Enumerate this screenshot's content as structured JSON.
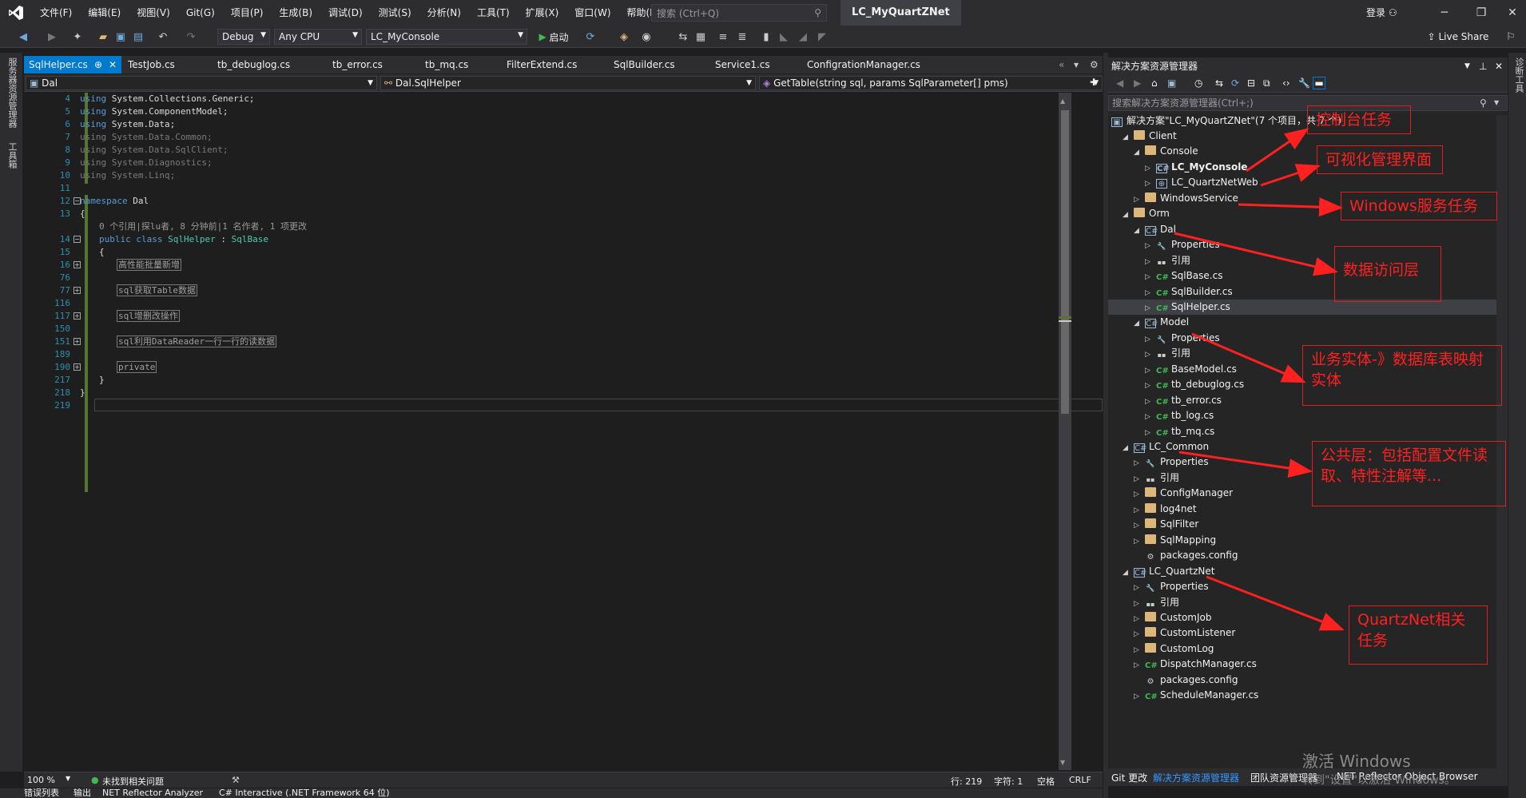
{
  "title_bar": {
    "menus": [
      "文件(F)",
      "编辑(E)",
      "视图(V)",
      "Git(G)",
      "项目(P)",
      "生成(B)",
      "调试(D)",
      "测试(S)",
      "分析(N)",
      "工具(T)",
      "扩展(X)",
      "窗口(W)",
      "帮助(H)"
    ],
    "search_placeholder": "搜索 (Ctrl+Q)",
    "solution_name": "LC_MyQuartZNet",
    "login": "登录",
    "window_buttons": [
      "─",
      "❐",
      "✕"
    ]
  },
  "toolbar": {
    "config": "Debug",
    "platform": "Any CPU",
    "startup_project": "LC_MyConsole",
    "start_label": "启动",
    "live_share": "Live Share"
  },
  "left_sidebar": {
    "server_explorer": "服务器资源管理器",
    "toolbox": "工具箱"
  },
  "tabs": [
    {
      "label": "SqlHelper.cs",
      "pin": "⊕",
      "close": "✕",
      "active": true
    },
    {
      "label": "TestJob.cs"
    },
    {
      "label": "tb_debuglog.cs"
    },
    {
      "label": "tb_error.cs"
    },
    {
      "label": "tb_mq.cs"
    },
    {
      "label": "FilterExtend.cs"
    },
    {
      "label": "SqlBuilder.cs"
    },
    {
      "label": "Service1.cs"
    },
    {
      "label": "ConfigrationManager.cs"
    }
  ],
  "navbar": {
    "project": "Dal",
    "type": "Dal.SqlHelper",
    "member": "GetTable(string sql, params SqlParameter[] pms)"
  },
  "code": {
    "lines": [
      {
        "n": "4",
        "kw": "using ",
        "rest": "System.Collections.Generic;"
      },
      {
        "n": "5",
        "kw": "using ",
        "rest": "System.ComponentModel;"
      },
      {
        "n": "6",
        "kw": "using ",
        "rest": "System.Data;"
      },
      {
        "n": "7",
        "kw": "using ",
        "rest": "System.Data.Common;"
      },
      {
        "n": "8",
        "kw": "using ",
        "rest": "System.Data.SqlClient;"
      },
      {
        "n": "9",
        "kw": "using ",
        "rest": "System.Diagnostics;"
      },
      {
        "n": "10",
        "kw": "using ",
        "rest": "System.Linq;"
      },
      {
        "n": "11",
        "kw": "",
        "rest": ""
      },
      {
        "n": "12",
        "kw": "namespace ",
        "rest": "Dal"
      },
      {
        "n": "13",
        "kw": "",
        "rest": "{"
      }
    ],
    "codelens": "0 个引用|探lu者, 8 分钟前|1 名作者, 1 项更改",
    "class_line": {
      "n": "14",
      "kw": "public class ",
      "name": "SqlHelper",
      "sep": " : ",
      "base": "SqlBase"
    },
    "brace_line": {
      "n": "15",
      "text": "{"
    },
    "regions": [
      {
        "n": "16",
        "label": "高性能批量新增"
      },
      {
        "n": "76",
        "label": ""
      },
      {
        "n": "77",
        "label": "sql获取Table数据"
      },
      {
        "n": "116",
        "label": ""
      },
      {
        "n": "117",
        "label": "sql增删改操作"
      },
      {
        "n": "150",
        "label": ""
      },
      {
        "n": "151",
        "label": "sql利用DataReader一行一行的读数据"
      },
      {
        "n": "189",
        "label": ""
      },
      {
        "n": "190",
        "label": "private"
      }
    ],
    "closing": [
      {
        "n": "217",
        "text": "}"
      },
      {
        "n": "218",
        "text": "}"
      },
      {
        "n": "219",
        "text": ""
      }
    ]
  },
  "status_bar": {
    "zoom": "100 %",
    "issues": "未找到相关问题",
    "line": "行: 219",
    "col": "字符: 1",
    "spaces": "空格",
    "eol": "CRLF"
  },
  "bottom_tabs": [
    "错误列表",
    "输出",
    "NET Reflector Analyzer",
    "C# Interactive (.NET Framework 64 位)"
  ],
  "solution_explorer": {
    "title": "解决方案资源管理器",
    "search_placeholder": "搜索解决方案资源管理器(Ctrl+;)",
    "solution": "解决方案\"LC_MyQuartZNet\"(7 个项目，共 7 个)",
    "nodes": [
      {
        "label": "Client",
        "level": 1,
        "icon": "folder",
        "arrow": "◢"
      },
      {
        "label": "Console",
        "level": 2,
        "icon": "folder",
        "arrow": "◢"
      },
      {
        "label": "LC_MyConsole",
        "level": 3,
        "icon": "proj",
        "arrow": "▷",
        "bold": true
      },
      {
        "label": "LC_QuartzNetWeb",
        "level": 3,
        "icon": "web",
        "arrow": "▷"
      },
      {
        "label": "WindowsService",
        "level": 2,
        "icon": "folder",
        "arrow": "▷"
      },
      {
        "label": "Orm",
        "level": 1,
        "icon": "folder",
        "arrow": "◢"
      },
      {
        "label": "Dal",
        "level": 2,
        "icon": "proj",
        "arrow": "◢"
      },
      {
        "label": "Properties",
        "level": 3,
        "icon": "wrench",
        "arrow": "▷"
      },
      {
        "label": "引用",
        "level": 3,
        "icon": "ref",
        "arrow": "▷"
      },
      {
        "label": "SqlBase.cs",
        "level": 3,
        "icon": "cs",
        "arrow": "▷"
      },
      {
        "label": "SqlBuilder.cs",
        "level": 3,
        "icon": "cs",
        "arrow": "▷"
      },
      {
        "label": "SqlHelper.cs",
        "level": 3,
        "icon": "cs",
        "arrow": "▷",
        "selected": true
      },
      {
        "label": "Model",
        "level": 2,
        "icon": "proj",
        "arrow": "◢"
      },
      {
        "label": "Properties",
        "level": 3,
        "icon": "wrench",
        "arrow": "▷"
      },
      {
        "label": "引用",
        "level": 3,
        "icon": "ref",
        "arrow": "▷"
      },
      {
        "label": "BaseModel.cs",
        "level": 3,
        "icon": "cs",
        "arrow": "▷"
      },
      {
        "label": "tb_debuglog.cs",
        "level": 3,
        "icon": "cs",
        "arrow": "▷"
      },
      {
        "label": "tb_error.cs",
        "level": 3,
        "icon": "cs",
        "arrow": "▷"
      },
      {
        "label": "tb_log.cs",
        "level": 3,
        "icon": "cs",
        "arrow": "▷"
      },
      {
        "label": "tb_mq.cs",
        "level": 3,
        "icon": "cs",
        "arrow": "▷"
      },
      {
        "label": "LC_Common",
        "level": 1,
        "icon": "proj",
        "arrow": "◢"
      },
      {
        "label": "Properties",
        "level": 2,
        "icon": "wrench",
        "arrow": "▷"
      },
      {
        "label": "引用",
        "level": 2,
        "icon": "ref",
        "arrow": "▷"
      },
      {
        "label": "ConfigManager",
        "level": 2,
        "icon": "folder",
        "arrow": "▷"
      },
      {
        "label": "log4net",
        "level": 2,
        "icon": "folder",
        "arrow": "▷"
      },
      {
        "label": "SqlFilter",
        "level": 2,
        "icon": "folder",
        "arrow": "▷"
      },
      {
        "label": "SqlMapping",
        "level": 2,
        "icon": "folder",
        "arrow": "▷"
      },
      {
        "label": "packages.config",
        "level": 2,
        "icon": "config",
        "arrow": ""
      },
      {
        "label": "LC_QuartzNet",
        "level": 1,
        "icon": "proj",
        "arrow": "◢"
      },
      {
        "label": "Properties",
        "level": 2,
        "icon": "wrench",
        "arrow": "▷"
      },
      {
        "label": "引用",
        "level": 2,
        "icon": "ref",
        "arrow": "▷"
      },
      {
        "label": "CustomJob",
        "level": 2,
        "icon": "folder",
        "arrow": "▷"
      },
      {
        "label": "CustomListener",
        "level": 2,
        "icon": "folder",
        "arrow": "▷"
      },
      {
        "label": "CustomLog",
        "level": 2,
        "icon": "folder",
        "arrow": "▷"
      },
      {
        "label": "DispatchManager.cs",
        "level": 2,
        "icon": "cs",
        "arrow": "▷"
      },
      {
        "label": "packages.config",
        "level": 2,
        "icon": "config",
        "arrow": ""
      },
      {
        "label": "ScheduleManager.cs",
        "level": 2,
        "icon": "cs",
        "arrow": "▷"
      }
    ],
    "bottom_tabs": [
      "Git 更改",
      "解决方案资源管理器",
      "团队资源管理器",
      ".NET Reflector Object Browser"
    ]
  },
  "right_sidebar": {
    "diagnostics": "诊断工具"
  },
  "annotations": [
    {
      "text": "控制台任务"
    },
    {
      "text": "可视化管理界面"
    },
    {
      "text": "Windows服务任务"
    },
    {
      "text": "数据访问层"
    },
    {
      "text": "业务实体-》数据库表映射实体"
    },
    {
      "text": "公共层：包括配置文件读取、特性注解等..."
    },
    {
      "text": "QuartzNet相关任务"
    }
  ],
  "watermark": {
    "line1": "激活 Windows",
    "line2": "转到\"设置\"以激活 Windows。"
  },
  "colors": {
    "accent": "#007acc",
    "annotation": "#ff2020",
    "keyword": "#569cd6",
    "type": "#4ec9b0",
    "line_number": "#2b91af"
  }
}
